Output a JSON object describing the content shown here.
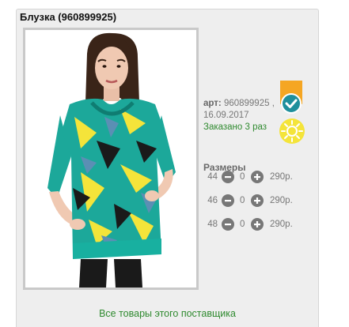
{
  "product": {
    "title": "Блузка (960899925)",
    "art_label": "арт:",
    "art_value": "960899925",
    "art_separator": ",",
    "date": "16.09.2017",
    "ordered": "Заказано 3 раз"
  },
  "sizes": {
    "title": "Размеры",
    "rows": [
      {
        "size": "44",
        "qty": "0",
        "price": "290р."
      },
      {
        "size": "46",
        "qty": "0",
        "price": "290р."
      },
      {
        "size": "48",
        "qty": "0",
        "price": "290р."
      }
    ]
  },
  "footer": {
    "supplier_link": "Все товары этого поставщика"
  },
  "colors": {
    "card_bg": "#eeeeee",
    "link_green": "#2f8a2f",
    "badge_orange": "#f5a623",
    "badge_teal": "#1f8f9c",
    "sun_yellow": "#f4e43a",
    "blouse_teal": "#1ca89a"
  },
  "icons": {
    "ribbon": "bookmark-ribbon-icon",
    "check": "check-circle-icon",
    "sun": "sun-icon",
    "minus": "minus-circle-icon",
    "plus": "plus-circle-icon"
  }
}
